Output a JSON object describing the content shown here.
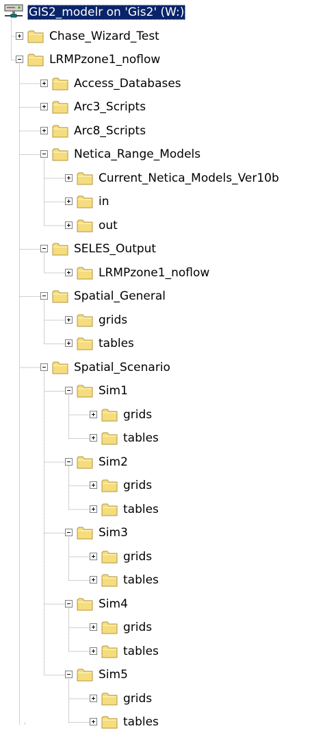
{
  "colors": {
    "selection_background": "#0a246a",
    "selection_text": "#ffffff",
    "folder_fill": "#f5dc7d",
    "folder_outline": "#b49641",
    "tree_line": "#a0a0a0"
  },
  "tree": {
    "nodes": [
      {
        "label": "GIS2_modelr on 'Gis2' (W:)",
        "depth": 0,
        "toggle": "none",
        "icon": "network-drive-icon",
        "selected": true
      },
      {
        "label": "Chase_Wizard_Test",
        "depth": 1,
        "toggle": "collapsed",
        "icon": "folder-icon",
        "selected": false
      },
      {
        "label": "LRMPzone1_noflow",
        "depth": 1,
        "toggle": "expanded",
        "icon": "folder-icon",
        "selected": false
      },
      {
        "label": "Access_Databases",
        "depth": 2,
        "toggle": "collapsed",
        "icon": "folder-icon",
        "selected": false
      },
      {
        "label": "Arc3_Scripts",
        "depth": 2,
        "toggle": "collapsed",
        "icon": "folder-icon",
        "selected": false
      },
      {
        "label": "Arc8_Scripts",
        "depth": 2,
        "toggle": "collapsed",
        "icon": "folder-icon",
        "selected": false
      },
      {
        "label": "Netica_Range_Models",
        "depth": 2,
        "toggle": "expanded",
        "icon": "folder-icon",
        "selected": false
      },
      {
        "label": "Current_Netica_Models_Ver10b",
        "depth": 3,
        "toggle": "collapsed",
        "icon": "folder-icon",
        "selected": false
      },
      {
        "label": "in",
        "depth": 3,
        "toggle": "collapsed",
        "icon": "folder-icon",
        "selected": false
      },
      {
        "label": "out",
        "depth": 3,
        "toggle": "collapsed",
        "icon": "folder-icon",
        "selected": false
      },
      {
        "label": "SELES_Output",
        "depth": 2,
        "toggle": "expanded",
        "icon": "folder-icon",
        "selected": false
      },
      {
        "label": "LRMPzone1_noflow",
        "depth": 3,
        "toggle": "collapsed",
        "icon": "folder-icon",
        "selected": false
      },
      {
        "label": "Spatial_General",
        "depth": 2,
        "toggle": "expanded",
        "icon": "folder-icon",
        "selected": false
      },
      {
        "label": "grids",
        "depth": 3,
        "toggle": "collapsed",
        "icon": "folder-icon",
        "selected": false
      },
      {
        "label": "tables",
        "depth": 3,
        "toggle": "collapsed",
        "icon": "folder-icon",
        "selected": false
      },
      {
        "label": "Spatial_Scenario",
        "depth": 2,
        "toggle": "expanded",
        "icon": "folder-icon",
        "selected": false
      },
      {
        "label": "Sim1",
        "depth": 3,
        "toggle": "expanded",
        "icon": "folder-icon",
        "selected": false
      },
      {
        "label": "grids",
        "depth": 4,
        "toggle": "collapsed",
        "icon": "folder-icon",
        "selected": false
      },
      {
        "label": "tables",
        "depth": 4,
        "toggle": "collapsed",
        "icon": "folder-icon",
        "selected": false
      },
      {
        "label": "Sim2",
        "depth": 3,
        "toggle": "expanded",
        "icon": "folder-icon",
        "selected": false
      },
      {
        "label": "grids",
        "depth": 4,
        "toggle": "collapsed",
        "icon": "folder-icon",
        "selected": false
      },
      {
        "label": "tables",
        "depth": 4,
        "toggle": "collapsed",
        "icon": "folder-icon",
        "selected": false
      },
      {
        "label": "Sim3",
        "depth": 3,
        "toggle": "expanded",
        "icon": "folder-icon",
        "selected": false
      },
      {
        "label": "grids",
        "depth": 4,
        "toggle": "collapsed",
        "icon": "folder-icon",
        "selected": false
      },
      {
        "label": "tables",
        "depth": 4,
        "toggle": "collapsed",
        "icon": "folder-icon",
        "selected": false
      },
      {
        "label": "Sim4",
        "depth": 3,
        "toggle": "expanded",
        "icon": "folder-icon",
        "selected": false
      },
      {
        "label": "grids",
        "depth": 4,
        "toggle": "collapsed",
        "icon": "folder-icon",
        "selected": false
      },
      {
        "label": "tables",
        "depth": 4,
        "toggle": "collapsed",
        "icon": "folder-icon",
        "selected": false
      },
      {
        "label": "Sim5",
        "depth": 3,
        "toggle": "expanded",
        "icon": "folder-icon",
        "selected": false
      },
      {
        "label": "grids",
        "depth": 4,
        "toggle": "collapsed",
        "icon": "folder-icon",
        "selected": false
      },
      {
        "label": "tables",
        "depth": 4,
        "toggle": "collapsed",
        "icon": "folder-icon",
        "selected": false
      }
    ]
  }
}
